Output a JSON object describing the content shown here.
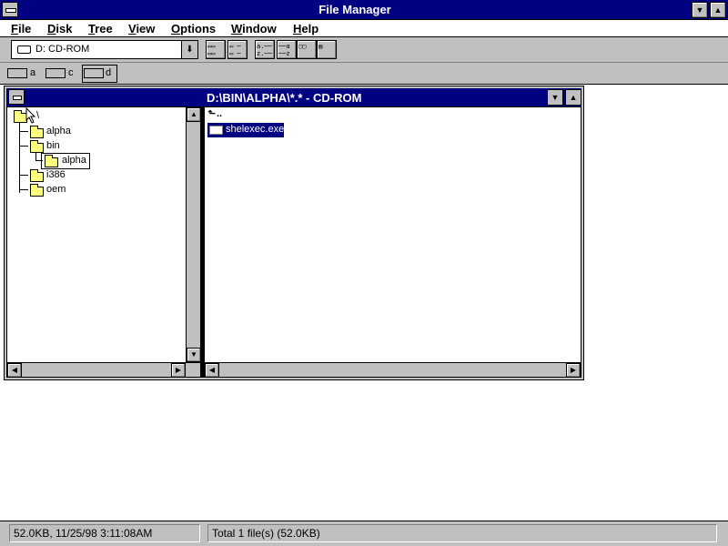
{
  "window": {
    "title": "File Manager"
  },
  "menu": [
    "File",
    "Disk",
    "Tree",
    "View",
    "Options",
    "Window",
    "Help"
  ],
  "toolbar": {
    "drive_selector": "D: CD-ROM",
    "buttons": [
      "large-icons-view",
      "small-icons-view",
      "sort-ascending",
      "sort-descending",
      "copy-to-clipboard",
      "properties"
    ]
  },
  "drives": [
    {
      "letter": "a",
      "type": "floppy"
    },
    {
      "letter": "c",
      "type": "hard-disk"
    },
    {
      "letter": "d",
      "type": "cd-rom",
      "selected": true
    }
  ],
  "child": {
    "title": "D:\\BIN\\ALPHA\\*.* - CD-ROM",
    "tree": {
      "root": "\\",
      "items": [
        {
          "label": "alpha",
          "level": 1
        },
        {
          "label": "bin",
          "level": 1
        },
        {
          "label": "alpha",
          "level": 2,
          "selected": true
        },
        {
          "label": "i386",
          "level": 1
        },
        {
          "label": "oem",
          "level": 1
        }
      ]
    },
    "files": [
      {
        "label": "..",
        "type": "parent"
      },
      {
        "label": "shelexec.exe",
        "type": "file",
        "selected": true
      }
    ]
  },
  "status": {
    "left": "52.0KB, 11/25/98 3:11:08AM",
    "right": "Total 1 file(s) (52.0KB)"
  },
  "colors": {
    "titlebar": "#000080",
    "face": "#c0c0c0",
    "folder": "#ffff80"
  }
}
